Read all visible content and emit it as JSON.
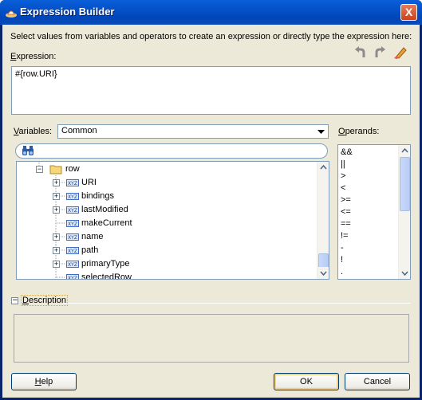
{
  "window": {
    "title": "Expression Builder",
    "close_glyph": "X"
  },
  "instructions": "Select values from variables and operators to create an expression or directly type the expression here:",
  "expression": {
    "label_u": "E",
    "label_rest": "xpression:",
    "value": "#{row.URI}"
  },
  "toolbar": {
    "icons": [
      "undo-icon",
      "redo-icon",
      "clear-icon"
    ]
  },
  "variables": {
    "label_u": "V",
    "label_rest": "ariables:",
    "selected": "Common"
  },
  "tree": {
    "root": "row",
    "children": [
      {
        "label": "URI",
        "expandable": true
      },
      {
        "label": "bindings",
        "expandable": true
      },
      {
        "label": "lastModified",
        "expandable": true
      },
      {
        "label": "makeCurrent",
        "expandable": false
      },
      {
        "label": "name",
        "expandable": true
      },
      {
        "label": "path",
        "expandable": true
      },
      {
        "label": "primaryType",
        "expandable": true
      },
      {
        "label": "selectedRow",
        "expandable": false
      }
    ],
    "type_icon_text": "XYZ"
  },
  "operands": {
    "label_u": "O",
    "label_rest": "perands:",
    "items": [
      "&&",
      "||",
      ">",
      "<",
      ">=",
      "<=",
      "==",
      "!=",
      "-",
      "!",
      "."
    ]
  },
  "description": {
    "label_u": "D",
    "label_rest": "escription"
  },
  "buttons": {
    "help_u": "H",
    "help_rest": "elp",
    "ok": "OK",
    "cancel": "Cancel"
  },
  "colors": {
    "title_bar": "#0451c9",
    "dialog_bg": "#ece9d8",
    "border": "#7f9db9"
  }
}
